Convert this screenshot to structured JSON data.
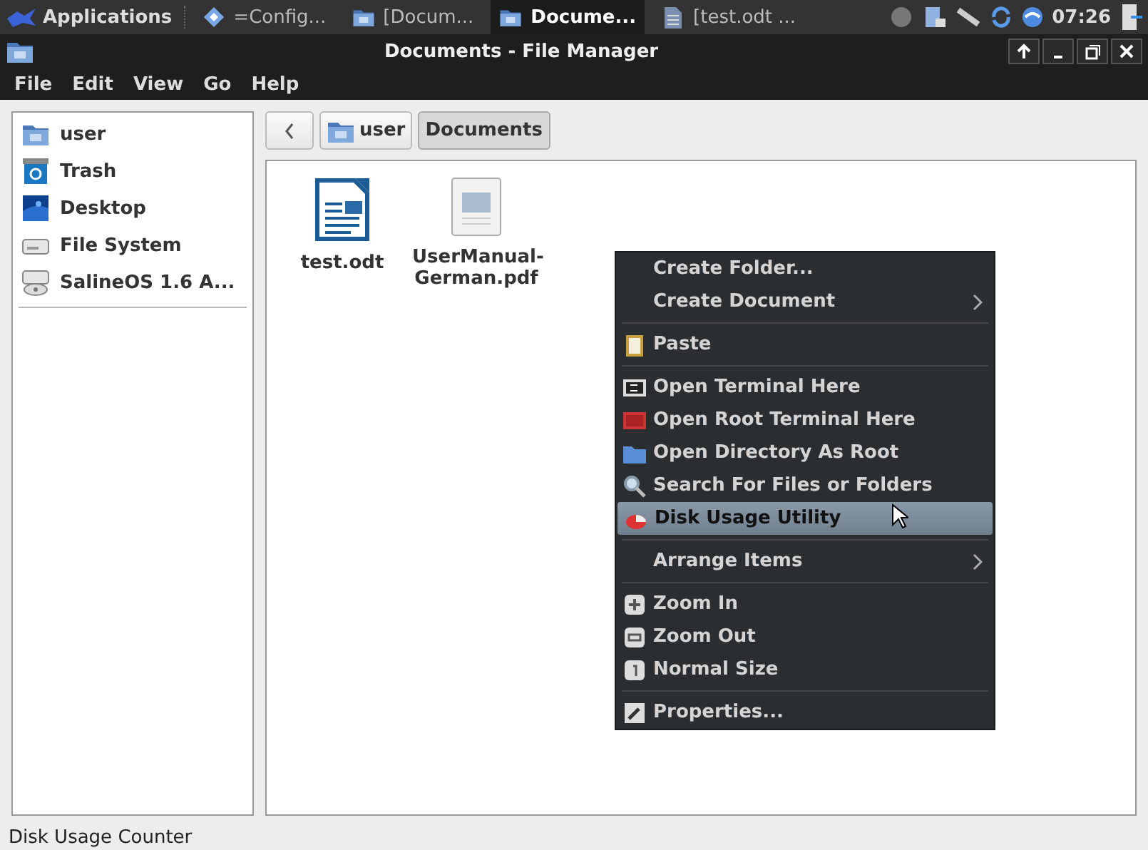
{
  "taskbar": {
    "launcher": "Applications",
    "tasks": [
      {
        "label": "=Config...",
        "selected": false
      },
      {
        "label": "[Docum...",
        "selected": false
      },
      {
        "label": "Docume...",
        "selected": true
      },
      {
        "label": "[test.odt ...",
        "selected": false
      }
    ],
    "clock": "07:26"
  },
  "window": {
    "title": "Documents - File Manager"
  },
  "menu_bar": [
    "File",
    "Edit",
    "View",
    "Go",
    "Help"
  ],
  "sidebar": {
    "items": [
      {
        "label": "user"
      },
      {
        "label": "Trash"
      },
      {
        "label": "Desktop"
      },
      {
        "label": "File System"
      },
      {
        "label": "SalineOS 1.6 A..."
      }
    ]
  },
  "path_bar": {
    "crumbs": [
      {
        "label": "user",
        "selected": false
      },
      {
        "label": "Documents",
        "selected": true
      }
    ]
  },
  "files": [
    {
      "label": "test.odt"
    },
    {
      "label": "UserManual-German.pdf"
    }
  ],
  "context_menu": [
    {
      "kind": "item",
      "label": "Create Folder...",
      "selected": false
    },
    {
      "kind": "submenu",
      "label": "Create Document",
      "selected": false
    },
    {
      "kind": "separator"
    },
    {
      "kind": "item",
      "label": "Paste",
      "selected": false
    },
    {
      "kind": "separator"
    },
    {
      "kind": "item",
      "label": "Open Terminal Here",
      "selected": false
    },
    {
      "kind": "item",
      "label": "Open Root Terminal Here",
      "selected": false
    },
    {
      "kind": "item",
      "label": "Open Directory As Root",
      "selected": false
    },
    {
      "kind": "item",
      "label": "Search For Files or Folders",
      "selected": false
    },
    {
      "kind": "item",
      "label": "Disk Usage Utility",
      "selected": true
    },
    {
      "kind": "separator"
    },
    {
      "kind": "submenu",
      "label": "Arrange Items",
      "selected": false
    },
    {
      "kind": "separator"
    },
    {
      "kind": "item",
      "label": "Zoom In",
      "selected": false
    },
    {
      "kind": "item",
      "label": "Zoom Out",
      "selected": false
    },
    {
      "kind": "item",
      "label": "Normal Size",
      "selected": false
    },
    {
      "kind": "separator"
    },
    {
      "kind": "item",
      "label": "Properties...",
      "selected": false
    }
  ],
  "status_bar": "Disk Usage Counter"
}
